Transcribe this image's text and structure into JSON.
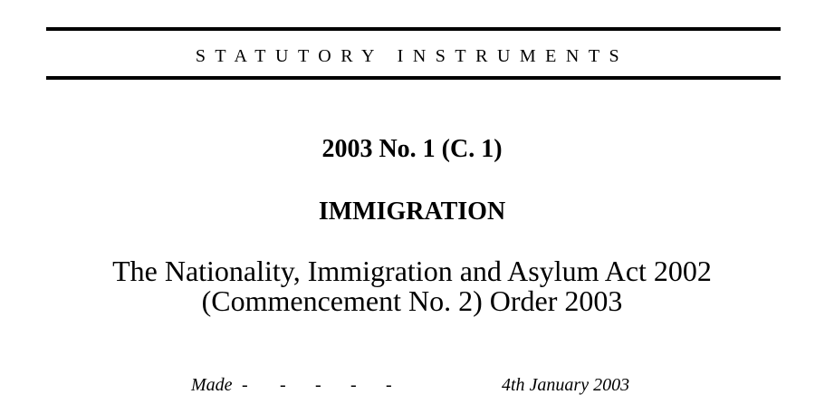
{
  "header": {
    "series_title": "STATUTORY INSTRUMENTS"
  },
  "instrument": {
    "number": "2003 No. 1 (C. 1)",
    "subject": "IMMIGRATION",
    "title_line1": "The Nationality, Immigration and Asylum Act 2002",
    "title_line2": "(Commencement No. 2) Order 2003"
  },
  "dates": {
    "made_label": "Made",
    "dash": "-",
    "made_date": "4th January 2003"
  }
}
